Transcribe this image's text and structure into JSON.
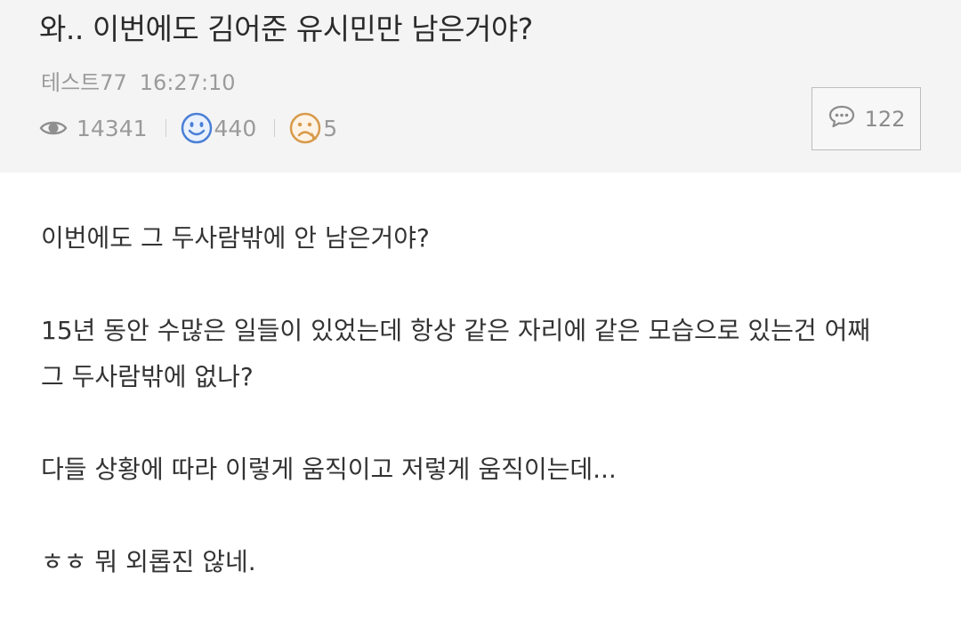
{
  "post": {
    "title": "와.. 이번에도 김어준 유시민만 남은거야?",
    "author": "테스트77",
    "time": "16:27:10",
    "stats": {
      "views": "14341",
      "likes": "440",
      "dislikes": "5"
    },
    "comments": "122",
    "body": {
      "line1": "이번에도 그 두사람밖에 안 남은거야?",
      "line2": "15년 동안 수많은 일들이 있었는데 항상 같은 자리에 같은 모습으로 있는건 어째",
      "line3": "그 두사람밖에 없나?",
      "line4": "다들 상황에 따라 이렇게 움직이고 저렇게 움직이는데...",
      "line5": "ㅎㅎ 뭐 외롭진 않네."
    }
  },
  "icons": {
    "views": "eye-icon",
    "likes": "smile-icon",
    "dislikes": "frown-icon",
    "comments": "speech-bubble-icon"
  },
  "colors": {
    "header_bg": "#f4f4f4",
    "like_blue": "#4a7fd6",
    "dislike_orange": "#d89a4a"
  }
}
